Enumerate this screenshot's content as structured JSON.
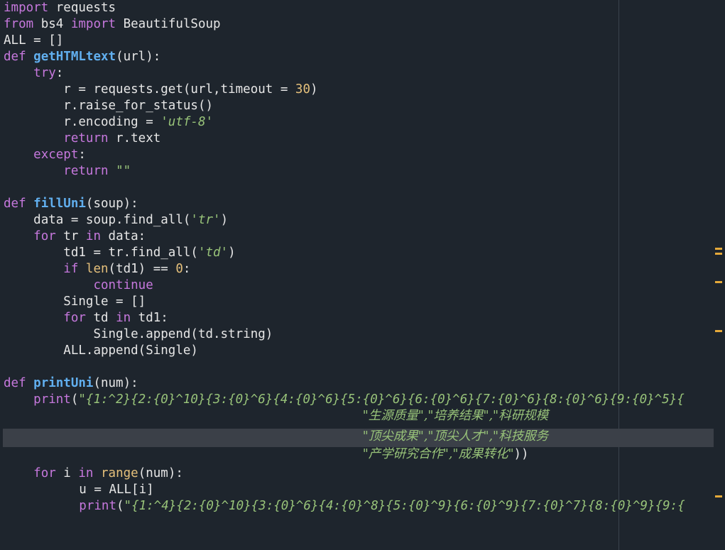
{
  "colors": {
    "background": "#1e252d",
    "keyword": "#c678dd",
    "function": "#61afef",
    "number": "#e5c07b",
    "string": "#98c379",
    "current_line": "#3b4048",
    "marker": "#e5a93a"
  },
  "code": {
    "l1": {
      "kw1": "import",
      "rest": " requests"
    },
    "l2": {
      "kw1": "from",
      "mid": " bs4 ",
      "kw2": "import",
      "rest": " BeautifulSoup"
    },
    "l3": {
      "text": "ALL = []"
    },
    "l4": {
      "kw": "def",
      "name": "getHTMLtext",
      "rest": "(url):"
    },
    "l5": {
      "indent": "    ",
      "kw": "try",
      "rest": ":"
    },
    "l6": {
      "indent": "        ",
      "pre": "r = requests.get(url,timeout = ",
      "num": "30",
      "post": ")"
    },
    "l7": {
      "indent": "        ",
      "text": "r.raise_for_status()"
    },
    "l8": {
      "indent": "        ",
      "pre": "r.encoding = ",
      "str": "'utf-8'"
    },
    "l9": {
      "indent": "        ",
      "kw": "return",
      "rest": " r.text"
    },
    "l10": {
      "indent": "    ",
      "kw": "except",
      "rest": ":"
    },
    "l11": {
      "indent": "        ",
      "kw": "return",
      "sp": " ",
      "str": "\"\""
    },
    "l13": {
      "kw": "def",
      "name": "fillUni",
      "rest": "(soup):"
    },
    "l14": {
      "indent": "    ",
      "pre": "data = soup.find_all(",
      "str": "'tr'",
      "post": ")"
    },
    "l15": {
      "indent": "    ",
      "kw1": "for",
      "mid": " tr ",
      "kw2": "in",
      "rest": " data:"
    },
    "l16": {
      "indent": "        ",
      "pre": "td1 = tr.find_all(",
      "str": "'td'",
      "post": ")"
    },
    "l17": {
      "indent": "        ",
      "kw": "if",
      "sp": " ",
      "bi": "len",
      "mid": "(td1) == ",
      "num": "0",
      "post": ":"
    },
    "l18": {
      "indent": "            ",
      "kw": "continue"
    },
    "l19": {
      "indent": "        ",
      "text": "Single = []"
    },
    "l20": {
      "indent": "        ",
      "kw1": "for",
      "mid": " td ",
      "kw2": "in",
      "rest": " td1:"
    },
    "l21": {
      "indent": "            ",
      "text": "Single.append(td.string)"
    },
    "l22": {
      "indent": "        ",
      "text": "ALL.append(Single)"
    },
    "l24": {
      "kw": "def",
      "name": "printUni",
      "rest": "(num):"
    },
    "l25": {
      "indent": "    ",
      "kw": "print",
      "pre": "(",
      "str": "\"{1:^2}{2:{0}^10}{3:{0}^6}{4:{0}^6}{5:{0}^6}{6:{0}^6}{7:{0}^6}{8:{0}^6}{9:{0}^5}{"
    },
    "l26": {
      "pad": "                                                ",
      "str": "\"生源质量\",\"培养结果\",\"科研规模"
    },
    "l27": {
      "pad": "                                                ",
      "str": "\"顶尖成果\",\"顶尖人才\",\"科技服务"
    },
    "l28": {
      "pad": "                                                ",
      "str": "\"产学研究合作\",\"成果转化\"",
      "post": "))"
    },
    "l30": {
      "indent": "    ",
      "kw1": "for",
      "mid": " i ",
      "kw2": "in",
      "sp": " ",
      "bi": "range",
      "rest": "(num):"
    },
    "l31": {
      "indent": "        ",
      "text": "u = ALL[i]"
    },
    "l32": {
      "indent": "        ",
      "kw": "print",
      "pre": "(",
      "str": "\"{1:^4}{2:{0}^10}{3:{0}^6}{4:{0}^8}{5:{0}^9}{6:{0}^9}{7:{0}^7}{8:{0}^9}{9:{"
    }
  }
}
